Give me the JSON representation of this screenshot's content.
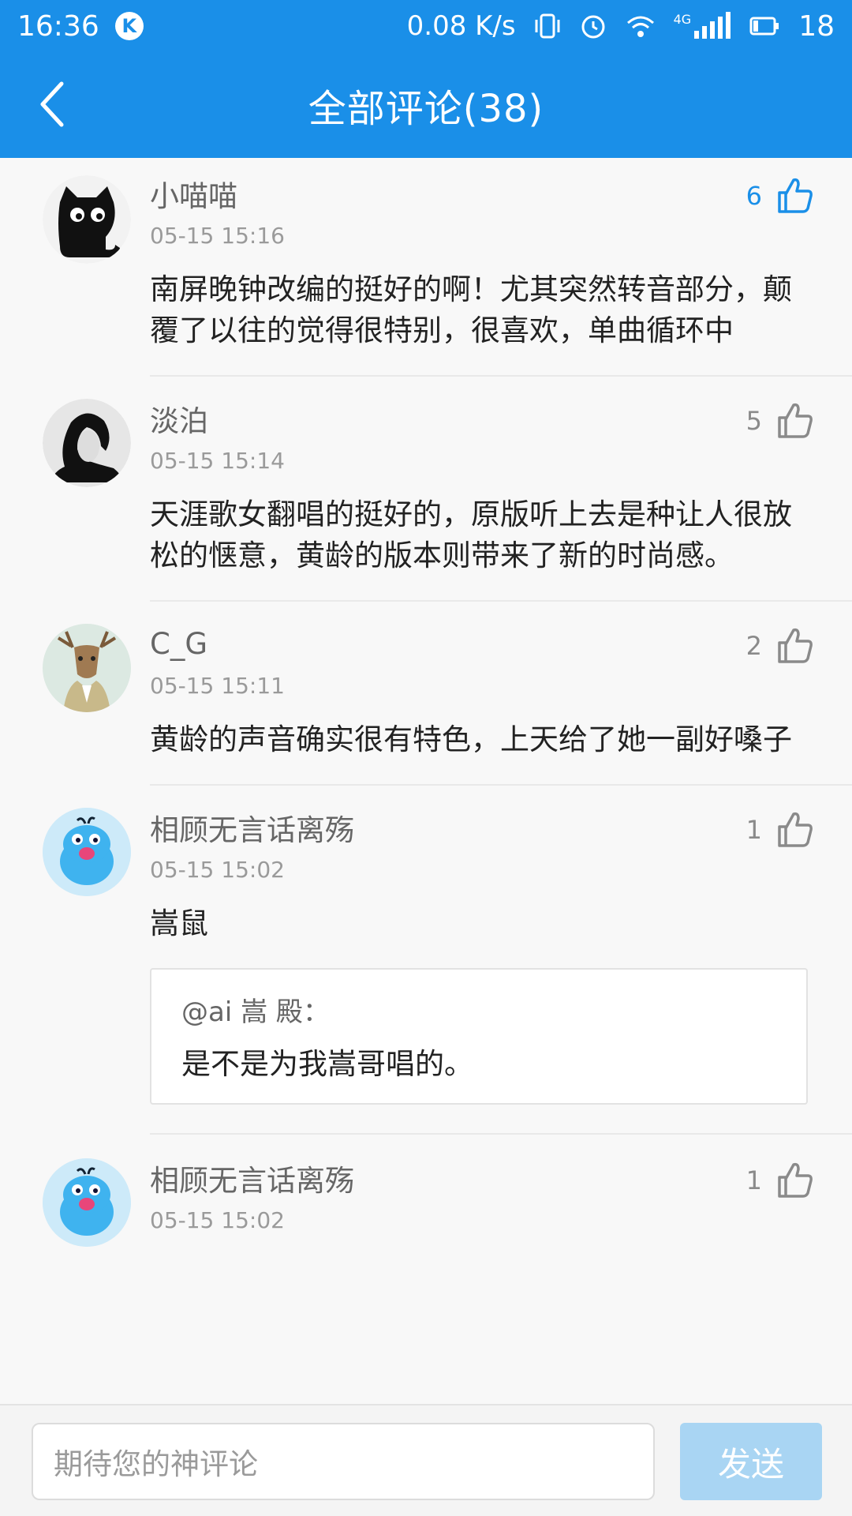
{
  "status_bar": {
    "time": "16:36",
    "app_badge": "K",
    "network_speed": "0.08 K/s",
    "network_type": "4G",
    "battery": "18"
  },
  "header": {
    "title": "全部评论(38)"
  },
  "comments": [
    {
      "name": "小喵喵",
      "time": "05-15 15:16",
      "likes": "6",
      "liked": true,
      "text": "南屏晚钟改编的挺好的啊！尤其突然转音部分，颠覆了以往的觉得很特别，很喜欢，单曲循环中"
    },
    {
      "name": "淡泊",
      "time": "05-15 15:14",
      "likes": "5",
      "liked": false,
      "text": "天涯歌女翻唱的挺好的，原版听上去是种让人很放松的惬意，黄龄的版本则带来了新的时尚感。"
    },
    {
      "name": "C_G",
      "time": "05-15 15:11",
      "likes": "2",
      "liked": false,
      "text": "黄龄的声音确实很有特色，上天给了她一副好嗓子"
    },
    {
      "name": "相顾无言话离殇",
      "time": "05-15 15:02",
      "likes": "1",
      "liked": false,
      "text": "嵩鼠",
      "quote": {
        "name": "@ai 嵩  殿：",
        "text": "是不是为我嵩哥唱的。"
      }
    },
    {
      "name": "相顾无言话离殇",
      "time": "05-15 15:02",
      "likes": "1",
      "liked": false
    }
  ],
  "input": {
    "placeholder": "期待您的神评论",
    "send_label": "发送"
  },
  "colors": {
    "primary": "#1a8fe8",
    "send_disabled": "#a9d5f3"
  }
}
